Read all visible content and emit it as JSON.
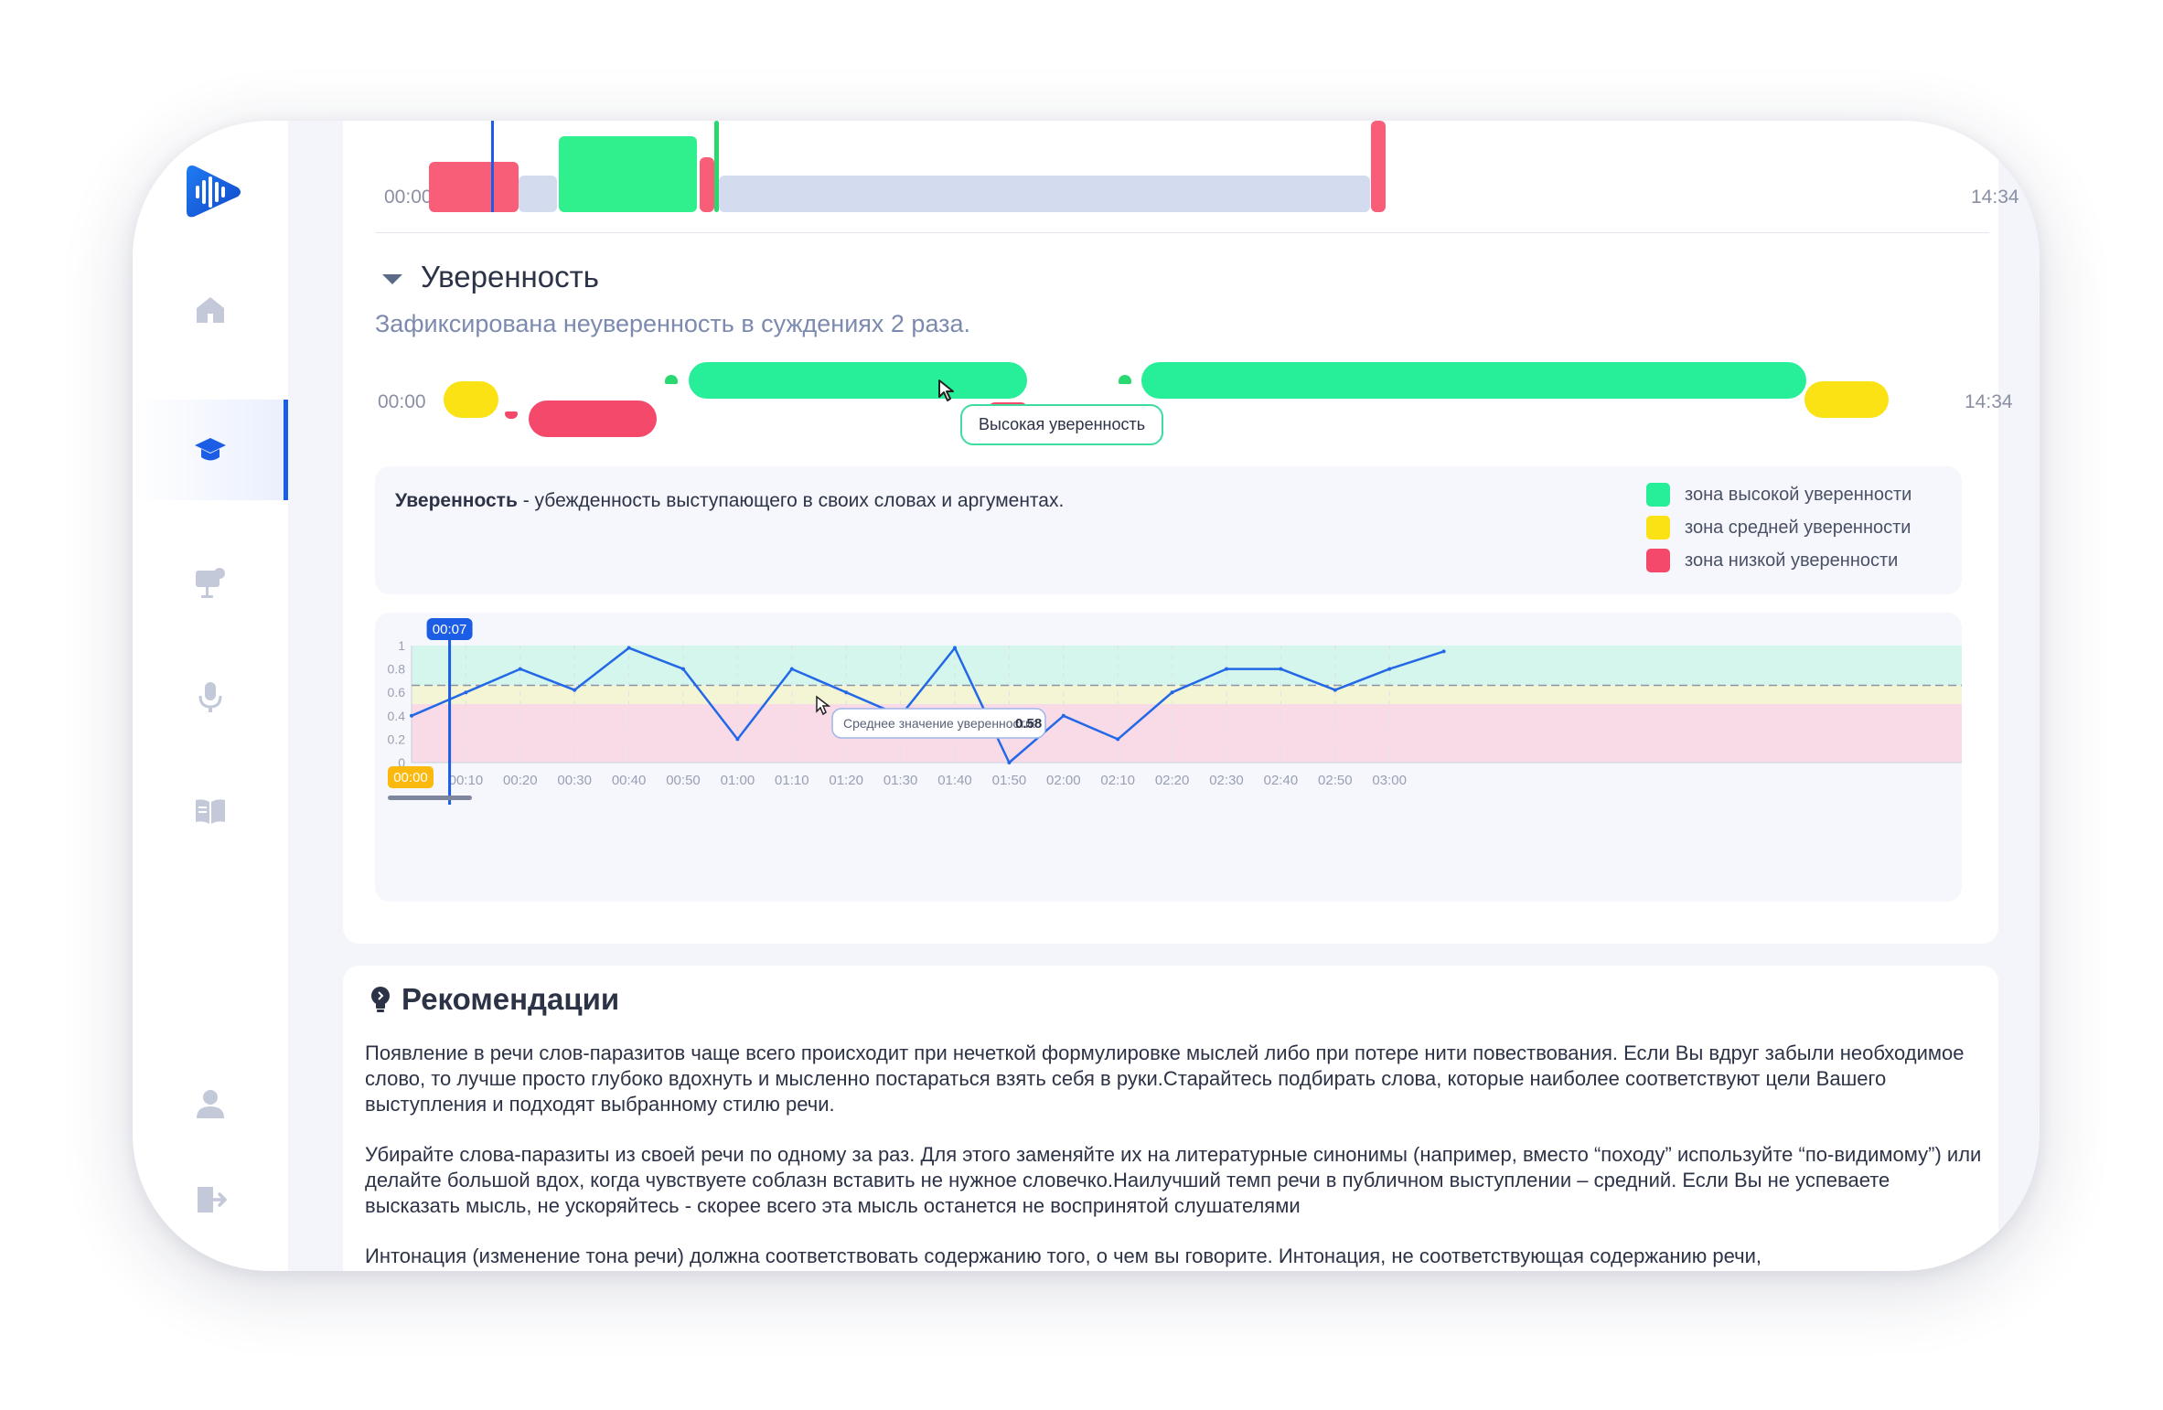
{
  "timeline_top": {
    "start": "00:00",
    "end": "14:34"
  },
  "confidence": {
    "title": "Уверенность",
    "subtitle": "Зафиксирована неуверенность в суждениях 2 раза.",
    "timeline_start": "00:00",
    "timeline_end": "14:34",
    "tooltip": "Высокая уверенность",
    "definition_term": "Уверенность",
    "definition_text": " - убежденность выступающего в своих словах и аргументах.",
    "legend": [
      {
        "label": "зона высокой уверенности",
        "color": "#27ee98"
      },
      {
        "label": "зона средней уверенности",
        "color": "#fbe214"
      },
      {
        "label": "зона низкой уверенности",
        "color": "#f5496b"
      }
    ]
  },
  "chart_data": {
    "type": "line",
    "x": [
      "00:00",
      "00:10",
      "00:20",
      "00:30",
      "00:40",
      "00:50",
      "01:00",
      "01:10",
      "01:20",
      "01:30",
      "01:40",
      "01:50",
      "02:00",
      "02:10",
      "02:20",
      "02:30",
      "02:40",
      "02:50",
      "03:00",
      "03:08"
    ],
    "tick_labels": [
      "00:00",
      "00:10",
      "00:20",
      "00:30",
      "00:40",
      "00:50",
      "01:00",
      "01:10",
      "01:20",
      "01:30",
      "01:40",
      "01:50",
      "02:00",
      "02:10",
      "02:20",
      "02:30",
      "02:40",
      "02:50",
      "03:00"
    ],
    "values": [
      0.4,
      0.6,
      0.8,
      0.62,
      0.98,
      0.8,
      0.2,
      0.8,
      0.6,
      0.4,
      0.98,
      0.0,
      0.4,
      0.2,
      0.6,
      0.8,
      0.8,
      0.62,
      0.8,
      0.95
    ],
    "y_ticks": [
      "1",
      "0.8",
      "0.6",
      "0.4",
      "0.2",
      "0"
    ],
    "ylim": [
      0,
      1
    ],
    "zones": [
      {
        "name": "high",
        "from": 0.66,
        "to": 1.0,
        "color": "#d5f6ec"
      },
      {
        "name": "medium",
        "from": 0.5,
        "to": 0.66,
        "color": "#f3f5d4"
      },
      {
        "name": "low",
        "from": 0.0,
        "to": 0.5,
        "color": "#f8dbe6"
      }
    ],
    "average_label": "Среднее значение уверенности:",
    "average_value": "0.58",
    "average_line": 0.66,
    "cursor_time": "00:07",
    "start_badge": "00:00",
    "grid": true
  },
  "recommendations": {
    "title": "Рекомендации",
    "paragraphs": [
      "Появление в речи слов-паразитов чаще всего происходит при нечеткой формулировке мыслей либо при потере нити повествования. Если Вы вдруг забыли необходимое слово, то лучше просто глубоко вдохнуть и мысленно постараться взять себя в руки.Старайтесь подбирать слова, которые наиболее соответствуют цели Вашего выступления и подходят выбранному стилю речи.",
      "Убирайте слова-паразиты из своей речи по одному за раз. Для этого заменяйте их на литературные синонимы (например, вместо “походу” используйте “по-видимому”) или делайте большой вдох, когда чувствуете соблазн вставить не нужное словечко.Наилучший темп речи в публичном выступлении – средний. Если Вы не успеваете высказать мысль, не ускоряйтесь - скорее всего эта мысль останется не воспринятой слушателями",
      "Интонация (изменение тона речи) должна соответствовать содержанию того, о чем вы говорите. Интонация, не соответствующая содержанию речи,"
    ]
  }
}
